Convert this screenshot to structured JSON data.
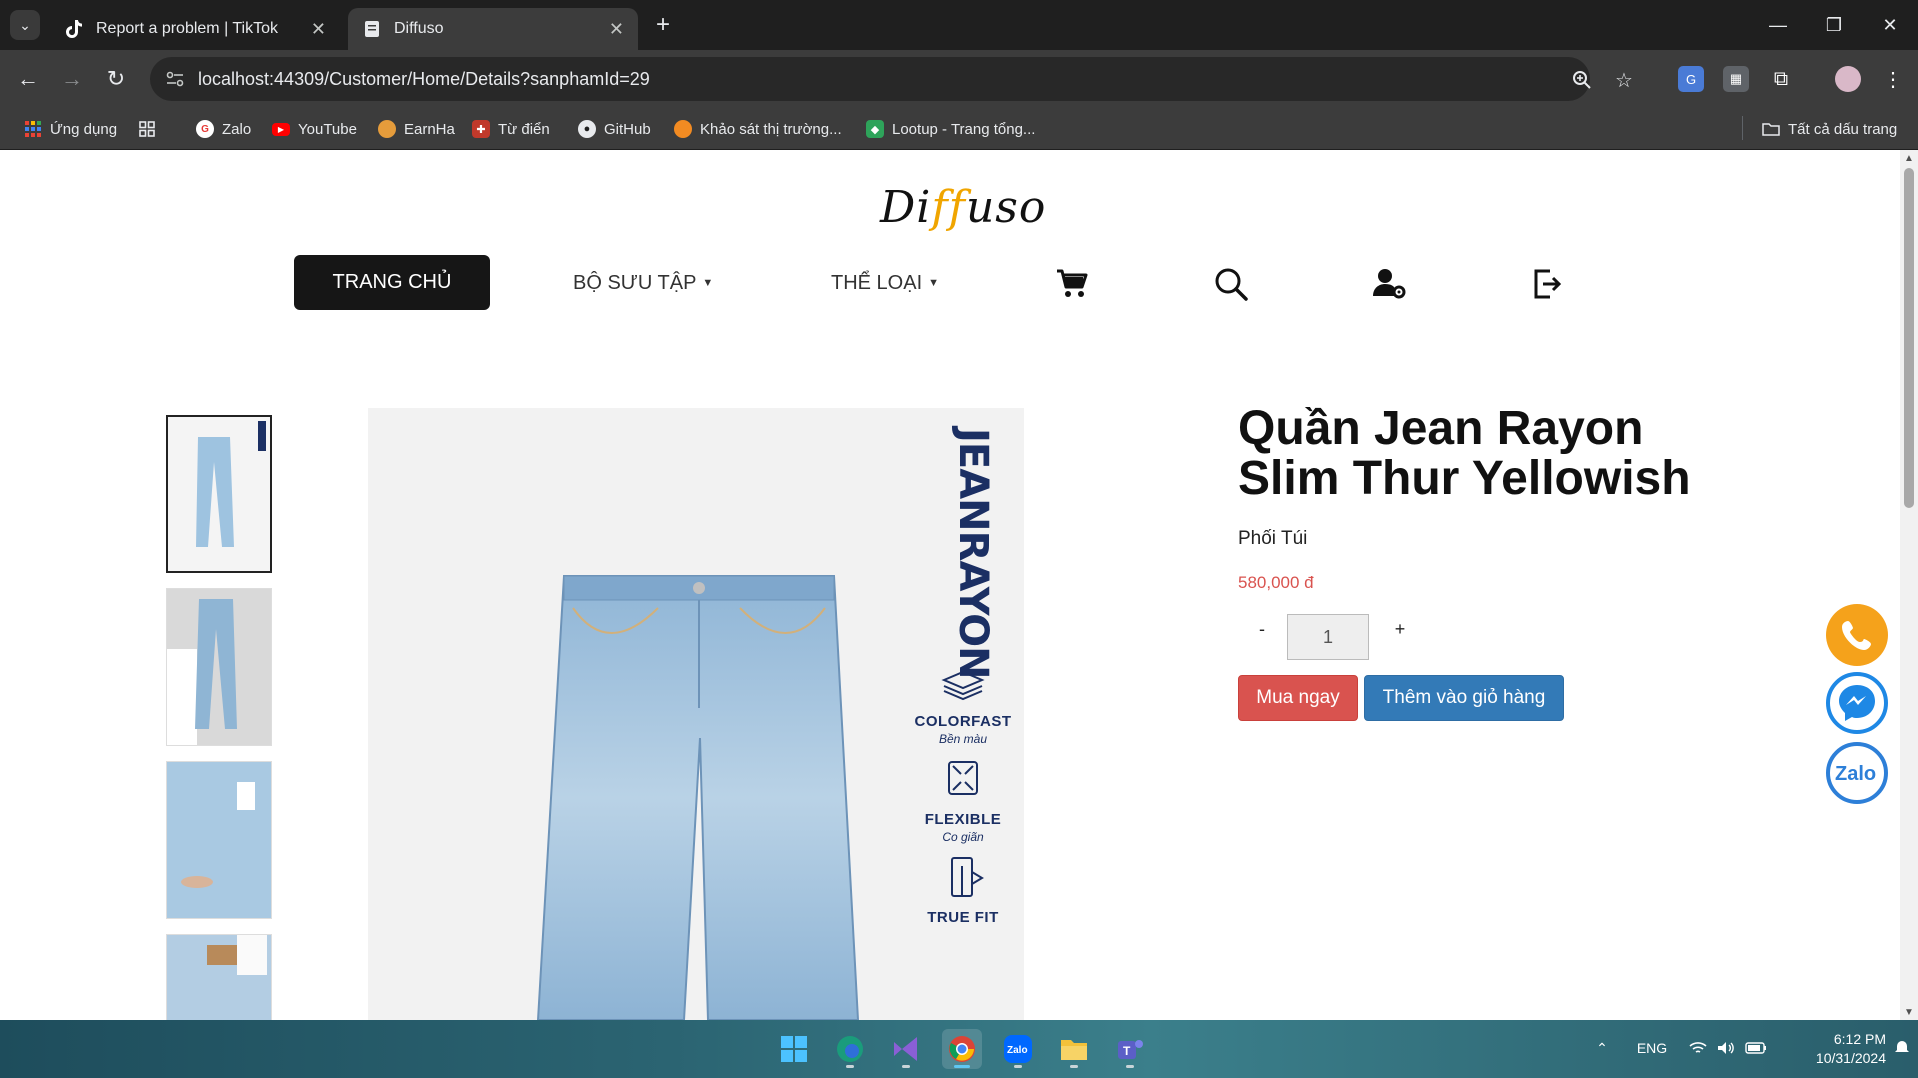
{
  "browser": {
    "tabs": [
      {
        "title": "Report a problem | TikTok",
        "active": false
      },
      {
        "title": "Diffuso",
        "active": true
      }
    ],
    "address": "localhost:44309/Customer/Home/Details?sanphamId=29",
    "bookmarks": [
      {
        "label": "Ứng dụng",
        "icon": "apps-grid-icon"
      },
      {
        "label": "Zalo",
        "icon": "zalo-icon"
      },
      {
        "label": "YouTube",
        "icon": "youtube-icon"
      },
      {
        "label": "EarnHa",
        "icon": "earnha-icon"
      },
      {
        "label": "Từ điển",
        "icon": "dictionary-icon"
      },
      {
        "label": "GitHub",
        "icon": "github-icon"
      },
      {
        "label": "Khảo sát thị trường...",
        "icon": "survey-icon"
      },
      {
        "label": "Lootup - Trang tổng...",
        "icon": "lootup-icon"
      }
    ],
    "all_bookmarks": "Tất cả dấu trang"
  },
  "site": {
    "logo": {
      "part1": "Di",
      "part2": "ff",
      "part3": "uso"
    },
    "nav": {
      "home": "TRANG CHỦ",
      "collections": "BỘ SƯU TẬP",
      "categories": "THỂ LOẠI"
    }
  },
  "product": {
    "title": "Quần Jean Rayon Slim Thur Yellowish",
    "subtitle": "Phối Túi",
    "price": "580,000 đ",
    "quantity": "1",
    "minus": "-",
    "plus": "+",
    "buy_now": "Mua ngay",
    "add_to_cart": "Thêm vào giỏ hàng",
    "image": {
      "brand": "JEANRAYON",
      "features": [
        {
          "name": "COLORFAST",
          "sub": "Bền màu"
        },
        {
          "name": "FLEXIBLE",
          "sub": "Co giãn"
        },
        {
          "name": "TRUE FIT",
          "sub": ""
        }
      ]
    }
  },
  "taskbar": {
    "language": "ENG",
    "time": "6:12 PM",
    "date": "10/31/2024"
  },
  "colors": {
    "price": "#d9534f",
    "buy_button": "#d9534f",
    "cart_button": "#337ab7",
    "phone_button": "#f5a21b",
    "messenger_button": "#1e88e5",
    "logo_accent": "#f0a500"
  }
}
